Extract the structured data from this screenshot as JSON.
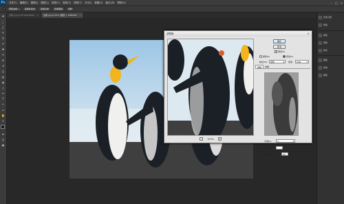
{
  "menubar": {
    "logo": "Ps",
    "items": [
      "文件(F)",
      "编辑(E)",
      "图像(I)",
      "图层(L)",
      "类型(Y)",
      "选择(S)",
      "滤镜(T)",
      "3D(D)",
      "视图(V)",
      "窗口(W)",
      "帮助(H)"
    ],
    "controls": [
      "–",
      "□",
      "×"
    ]
  },
  "optbar": {
    "buttons": [
      "调整边缘...",
      "选择并遮住",
      "选择主体",
      "选择图层",
      "调整"
    ]
  },
  "tabs": [
    {
      "label": "企鹅.jpg @ 50%(RGB/8#)",
      "active": false
    },
    {
      "label": "企鹅.jpg @ 50% (图层 1, RGB/8#)",
      "active": true
    }
  ],
  "toolbar": {
    "tools": [
      "move-tool",
      "marquee-tool",
      "lasso-tool",
      "quick-select-tool",
      "crop-tool",
      "eyedropper-tool",
      "healing-tool",
      "brush-tool",
      "stamp-tool",
      "history-brush-tool",
      "eraser-tool",
      "gradient-tool",
      "blur-tool",
      "dodge-tool",
      "pen-tool",
      "type-tool",
      "path-select-tool",
      "shape-tool",
      "hand-tool",
      "zoom-tool"
    ],
    "glyphs": [
      "✥",
      "⬚",
      "ʆ",
      "✎",
      "⌗",
      "✐",
      "✚",
      "✎",
      "⊕",
      "↺",
      "◫",
      "▤",
      "◉",
      "○",
      "✒",
      "T",
      "↖",
      "▭",
      "✋",
      "⚲"
    ],
    "fg_color": "#1a1a1a",
    "bg_color": "#ffffff",
    "extra_glyphs": [
      "⇆",
      "◫",
      "▣"
    ]
  },
  "rightpanel": {
    "group1": [
      {
        "icon": "history-icon",
        "label": "历史记录"
      },
      {
        "icon": "swatches-icon",
        "label": "色板"
      }
    ],
    "group2": [
      {
        "icon": "color-icon",
        "label": "颜色"
      },
      {
        "icon": "adjustments-icon",
        "label": "调整"
      },
      {
        "icon": "styles-icon",
        "label": "样式"
      }
    ],
    "group3": [
      {
        "icon": "layers-icon",
        "label": "图层"
      },
      {
        "icon": "channels-icon",
        "label": "通道"
      },
      {
        "icon": "paths-icon",
        "label": "路径"
      }
    ]
  },
  "dialog": {
    "title": "滤镜库",
    "close": "×",
    "ok_label": "确定",
    "cancel_label": "取消",
    "preview_label": "预览(P)",
    "preview_checked": true,
    "section_label": "设置",
    "radio1": "颜色(S)",
    "radio2": "复合(A)",
    "mode_label": "模式(M):",
    "mode_value": "颜色",
    "channel_label": "通道:",
    "channel_value": "RGB",
    "side_tab1": "参数",
    "side_tab2": "效果",
    "param_a_label": "平滑(S):",
    "param_a_value": "4",
    "param_b_label": "细节(D):",
    "param_b_value": "",
    "param_c_label": "亮度差值(T):",
    "param_c_value": "40",
    "param_c_unit": "%",
    "zoom_minus": "−",
    "zoom_value": "100%",
    "zoom_plus": "+",
    "slider_value": 0.45
  },
  "colors": {
    "sky_top": "#9cc6e6",
    "sky_bottom": "#dde9f1",
    "ground": "#3f3f3f",
    "penguin_dark": "#1b1f26",
    "penguin_yellow": "#f2b51d",
    "penguin_white": "#f0f0ee"
  }
}
